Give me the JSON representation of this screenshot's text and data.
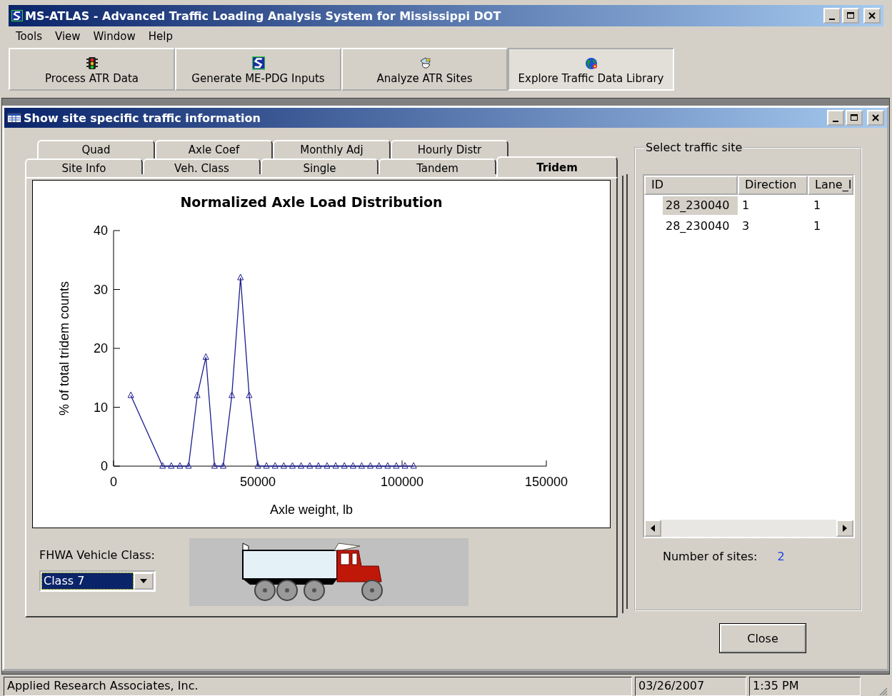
{
  "window": {
    "title": "MS-ATLAS - Advanced Traffic Loading Analysis System for Mississippi DOT"
  },
  "menu": [
    "Tools",
    "View",
    "Window",
    "Help"
  ],
  "toolbar": [
    {
      "label": "Process ATR Data",
      "kind": "traffic-light",
      "pressed": false
    },
    {
      "label": "Generate ME-PDG Inputs",
      "kind": "logo",
      "pressed": false
    },
    {
      "label": "Analyze ATR Sites",
      "kind": "hand",
      "pressed": false
    },
    {
      "label": "Explore Traffic Data Library",
      "kind": "globe",
      "pressed": true
    }
  ],
  "child_window": {
    "title": "Show site specific traffic information"
  },
  "tabs": {
    "back_row": [
      {
        "label": "Quad",
        "selected": false
      },
      {
        "label": "Axle Coef",
        "selected": false
      },
      {
        "label": "Monthly Adj",
        "selected": false
      },
      {
        "label": "Hourly Distr",
        "selected": false
      }
    ],
    "front_row": [
      {
        "label": "Site Info",
        "selected": false
      },
      {
        "label": "Veh. Class",
        "selected": false
      },
      {
        "label": "Single",
        "selected": false
      },
      {
        "label": "Tandem",
        "selected": false
      },
      {
        "label": "Tridem",
        "selected": true
      }
    ]
  },
  "chart": {
    "chart_data": {
      "type": "line",
      "title": "Normalized Axle Load Distribution",
      "xlabel": "Axle weight, lb",
      "ylabel": "% of total tridem counts",
      "x": [
        6000,
        17000,
        20000,
        23000,
        26000,
        29000,
        32000,
        35000,
        38000,
        41000,
        44000,
        47000,
        50000,
        53000,
        56000,
        59000,
        62000,
        65000,
        68000,
        71000,
        74000,
        77000,
        80000,
        83000,
        86000,
        89000,
        92000,
        95000,
        98000,
        101000,
        104000
      ],
      "series": [
        {
          "color": "#1c1c8c",
          "marker": "triangle",
          "values": [
            12,
            0,
            0,
            0,
            0,
            12,
            18.5,
            0,
            0,
            12,
            32,
            12,
            0,
            0,
            0,
            0,
            0,
            0,
            0,
            0,
            0,
            0,
            0,
            0,
            0,
            0,
            0,
            0,
            0,
            0,
            0
          ]
        }
      ],
      "xlim": [
        0,
        150000
      ],
      "ylim": [
        0,
        40
      ],
      "xticks": [
        0,
        50000,
        100000,
        150000
      ],
      "yticks": [
        0,
        10,
        20,
        30,
        40
      ]
    }
  },
  "vehicle_class": {
    "label": "FHWA Vehicle Class:",
    "value": "Class 7"
  },
  "site_panel": {
    "title": "Select traffic site",
    "columns": [
      "ID",
      "Direction",
      "Lane_I"
    ],
    "rows": [
      {
        "cells": [
          "28_230040",
          "1",
          "1"
        ],
        "selected": true
      },
      {
        "cells": [
          "28_230040",
          "3",
          "1"
        ],
        "selected": false
      }
    ],
    "count_label": "Number of sites:",
    "count": "2"
  },
  "close_button": "Close",
  "status_bar": [
    "Applied Research Associates, Inc.",
    "03/26/2007",
    "1:35 PM"
  ]
}
